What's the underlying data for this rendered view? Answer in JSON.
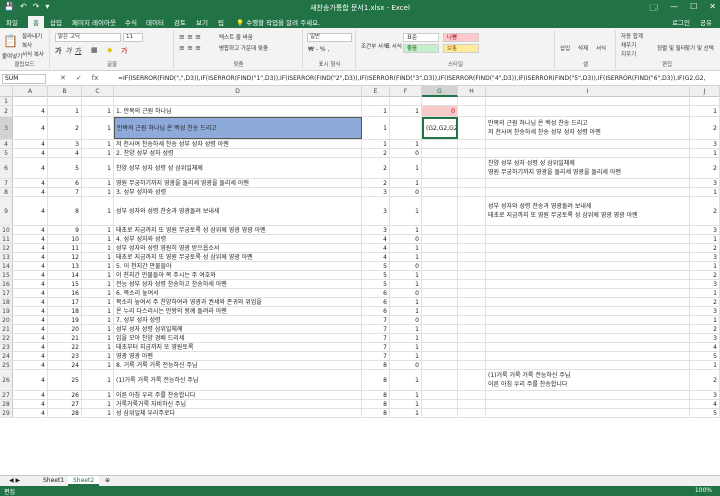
{
  "window": {
    "title": "새찬송가통합 문서1.xlsx - Excel",
    "user": "로그인"
  },
  "quick_access": [
    "💾",
    "↶",
    "↷",
    "▾"
  ],
  "win_controls": [
    "🗔",
    "—",
    "☐",
    "✕"
  ],
  "ribbon_tabs": [
    "파일",
    "홈",
    "삽입",
    "페이지 레이아웃",
    "수식",
    "데이터",
    "검토",
    "보기",
    "팁",
    "💡 수행할 작업을 알려 주세요."
  ],
  "ribbon_right": [
    "공유"
  ],
  "ribbon": {
    "clipboard": {
      "paste": "붙여넣기",
      "cut": "잘라내기",
      "copy": "복사",
      "format_painter": "서식 복사",
      "label": "클립보드"
    },
    "font": {
      "name": "맑은 고딕",
      "size": "11",
      "label": "글꼴"
    },
    "alignment": {
      "wrap": "텍스트 줄 바꿈",
      "merge": "병합하고 가운데 맞춤",
      "label": "맞춤"
    },
    "number": {
      "format": "일반",
      "label": "표시 형식"
    },
    "styles": {
      "cond": "조건부 서식",
      "table": "표 서식",
      "normal": "표준",
      "bad": "나쁨",
      "good": "좋음",
      "neutral": "보통",
      "label": "스타일"
    },
    "cells": {
      "insert": "삽입",
      "delete": "삭제",
      "format": "서식",
      "label": "셀"
    },
    "editing": {
      "autosum": "자동 합계",
      "fill": "채우기",
      "clear": "지우기",
      "sort": "정렬 및 필터",
      "find": "찾기 및 선택",
      "label": "편집"
    }
  },
  "formula_bar": {
    "name_box": "SUM",
    "icons": [
      "✕",
      "✓",
      "fx"
    ],
    "formula": "=IF(ISERROR(FIND(\",\",D3)),IF(ISERROR(FIND(\"1\",D3)),IF(ISERROR(FIND(\"2\",D3)),IF(ISERROR(FIND(\"3\",D3)),IF(ISERROR(FIND(\"4\",D3)),IF(ISERROR(FIND(\"5\",D3)),IF(ISERROR(FIND(\"6\",D3)),IF(G2,G2,"
  },
  "columns": [
    "A",
    "B",
    "C",
    "D",
    "E",
    "F",
    "G",
    "H",
    "I",
    "J"
  ],
  "rows": [
    {
      "n": "1",
      "A": "",
      "B": "",
      "C": "",
      "D": "",
      "E": "",
      "F": "",
      "G": "",
      "H": "",
      "I": "",
      "J": ""
    },
    {
      "n": "2",
      "A": "4",
      "B": "1",
      "C": "1",
      "D": "1. 만복의 근원 하나님",
      "E": "1",
      "F": "1",
      "G": "0",
      "H": "",
      "I": "",
      "J": "1"
    },
    {
      "n": "3",
      "A": "4",
      "B": "2",
      "C": "1",
      "D": "만복의 근원 하나님 온 백성 찬송 드리고",
      "E": "1",
      "F": "",
      "G": "(G2,G2,G2",
      "H": "",
      "I": "만복의 근원 하나님 온 백성 찬송 드리고\n저 천사여 찬송하세 찬송 성부 성자 성령 아멘",
      "J": "2"
    },
    {
      "n": "4",
      "A": "4",
      "B": "3",
      "C": "1",
      "D": "저 천사여 찬송하세 찬송 성부 성자 성령 아멘",
      "E": "1",
      "F": "1",
      "G": "",
      "H": "",
      "I": "",
      "J": "3"
    },
    {
      "n": "5",
      "A": "4",
      "B": "4",
      "C": "1",
      "D": "2. 찬양 성부 성자 성령",
      "E": "2",
      "F": "0",
      "G": "",
      "H": "",
      "I": "",
      "J": "1"
    },
    {
      "n": "6",
      "A": "4",
      "B": "5",
      "C": "1",
      "D": "찬양 성부 성자 성령 성 삼위일체께",
      "E": "2",
      "F": "1",
      "G": "",
      "H": "",
      "I": "찬양 성부 성자 성령 성 삼위일체께\n영원 무궁하기까지 영광을 돌리세 영광을 돌리세 아멘",
      "J": "2"
    },
    {
      "n": "7",
      "A": "4",
      "B": "6",
      "C": "1",
      "D": "영원 무궁하기까지 영광을 돌리세 영광을 돌리세 아멘",
      "E": "2",
      "F": "1",
      "G": "",
      "H": "",
      "I": "",
      "J": "3"
    },
    {
      "n": "8",
      "A": "4",
      "B": "7",
      "C": "1",
      "D": "3. 성부 성자와 성령",
      "E": "3",
      "F": "0",
      "G": "",
      "H": "",
      "I": "",
      "J": "1"
    },
    {
      "n": "9",
      "A": "4",
      "B": "8",
      "C": "1",
      "D": "성부 성자와 성령 찬송과 영광돌려 보내세",
      "E": "3",
      "F": "1",
      "G": "",
      "H": "",
      "I": "성부 성자와 성령 찬송과 영광돌려 보내세\n태초로 지금까지 또 영원 무궁토록 성 삼위께 영광 영광 아멘",
      "J": "2"
    },
    {
      "n": "10",
      "A": "4",
      "B": "9",
      "C": "1",
      "D": "태초로 지금까지 또 영원 무궁토록 성 삼위께 영광 영광 아멘",
      "E": "3",
      "F": "1",
      "G": "",
      "H": "",
      "I": "",
      "J": "3"
    },
    {
      "n": "11",
      "A": "4",
      "B": "10",
      "C": "1",
      "D": "4. 성부 성자와 성령",
      "E": "4",
      "F": "0",
      "G": "",
      "H": "",
      "I": "",
      "J": "1"
    },
    {
      "n": "12",
      "A": "4",
      "B": "11",
      "C": "1",
      "D": "성부 성자와 성령 영원히 영광 받으옵소서",
      "E": "4",
      "F": "1",
      "G": "",
      "H": "",
      "I": "",
      "J": "2"
    },
    {
      "n": "13",
      "A": "4",
      "B": "12",
      "C": "1",
      "D": "태초로 지금까지 또 영원 무궁토록 성 삼위께 영광 아멘",
      "E": "4",
      "F": "1",
      "G": "",
      "H": "",
      "I": "",
      "J": "3"
    },
    {
      "n": "14",
      "A": "4",
      "B": "13",
      "C": "1",
      "D": "5. 이 천지간 만물들아",
      "E": "5",
      "F": "0",
      "G": "",
      "H": "",
      "I": "",
      "J": "1"
    },
    {
      "n": "15",
      "A": "4",
      "B": "14",
      "C": "1",
      "D": "이 천지간 만물들아 복 주시는 주 여호와",
      "E": "5",
      "F": "1",
      "G": "",
      "H": "",
      "I": "",
      "J": "2"
    },
    {
      "n": "16",
      "A": "4",
      "B": "15",
      "C": "1",
      "D": "전능 성부 성자 성령 찬송하고 찬송하세 아멘",
      "E": "5",
      "F": "1",
      "G": "",
      "H": "",
      "I": "",
      "J": "3"
    },
    {
      "n": "17",
      "A": "4",
      "B": "16",
      "C": "1",
      "D": "6. 목소리 높여서",
      "E": "6",
      "F": "0",
      "G": "",
      "H": "",
      "I": "",
      "J": "1"
    },
    {
      "n": "18",
      "A": "4",
      "B": "17",
      "C": "1",
      "D": "목소리 높여서 주 찬양하여라 영광과 권세와 존귀와 위엄을",
      "E": "6",
      "F": "1",
      "G": "",
      "H": "",
      "I": "",
      "J": "2"
    },
    {
      "n": "19",
      "A": "4",
      "B": "18",
      "C": "1",
      "D": "온 누리 다스리시는 만왕의 왕께 돌려라 아멘",
      "E": "6",
      "F": "1",
      "G": "",
      "H": "",
      "I": "",
      "J": "3"
    },
    {
      "n": "20",
      "A": "4",
      "B": "19",
      "C": "1",
      "D": "7. 성부 성자 성령",
      "E": "7",
      "F": "0",
      "G": "",
      "H": "",
      "I": "",
      "J": "1"
    },
    {
      "n": "21",
      "A": "4",
      "B": "20",
      "C": "1",
      "D": "성부 성자 성령 삼위일체께",
      "E": "7",
      "F": "1",
      "G": "",
      "H": "",
      "I": "",
      "J": "2"
    },
    {
      "n": "22",
      "A": "4",
      "B": "21",
      "C": "1",
      "D": "입을 모아 찬양 경배 드리세",
      "E": "7",
      "F": "1",
      "G": "",
      "H": "",
      "I": "",
      "J": "3"
    },
    {
      "n": "23",
      "A": "4",
      "B": "22",
      "C": "1",
      "D": "태초부터 지금까지 또 영원토록",
      "E": "7",
      "F": "1",
      "G": "",
      "H": "",
      "I": "",
      "J": "4"
    },
    {
      "n": "24",
      "A": "4",
      "B": "23",
      "C": "1",
      "D": "영광 영광 아멘",
      "E": "7",
      "F": "1",
      "G": "",
      "H": "",
      "I": "",
      "J": "5"
    },
    {
      "n": "25",
      "A": "4",
      "B": "24",
      "C": "1",
      "D": "8. 거룩 거룩 거룩 전능하신 주님",
      "E": "8",
      "F": "0",
      "G": "",
      "H": "",
      "I": "",
      "J": "1"
    },
    {
      "n": "26",
      "A": "4",
      "B": "25",
      "C": "1",
      "D": "(1)거룩 거룩 거룩 전능하신 주님",
      "E": "8",
      "F": "1",
      "G": "",
      "H": "",
      "I": "(1)거룩 거룩 거룩 전능하신 주님\n이른 아침 우리 주를 찬송합니다",
      "J": "2"
    },
    {
      "n": "27",
      "A": "4",
      "B": "26",
      "C": "1",
      "D": "이른 아침 우리 주를 찬송합니다",
      "E": "8",
      "F": "1",
      "G": "",
      "H": "",
      "I": "",
      "J": "3"
    },
    {
      "n": "28",
      "A": "4",
      "B": "27",
      "C": "1",
      "D": "거룩거룩거룩 자비하신 주님",
      "E": "8",
      "F": "1",
      "G": "",
      "H": "",
      "I": "",
      "J": "4"
    },
    {
      "n": "29",
      "A": "4",
      "B": "28",
      "C": "1",
      "D": "성 삼위일체 우리주로다",
      "E": "8",
      "F": "1",
      "G": "",
      "H": "",
      "I": "",
      "J": "5"
    }
  ],
  "sheets": {
    "nav": "◀ ▶",
    "tabs": [
      "Sheet1",
      "Sheet2"
    ],
    "add": "⊕"
  },
  "status": {
    "mode": "편집",
    "zoom": "100%"
  }
}
